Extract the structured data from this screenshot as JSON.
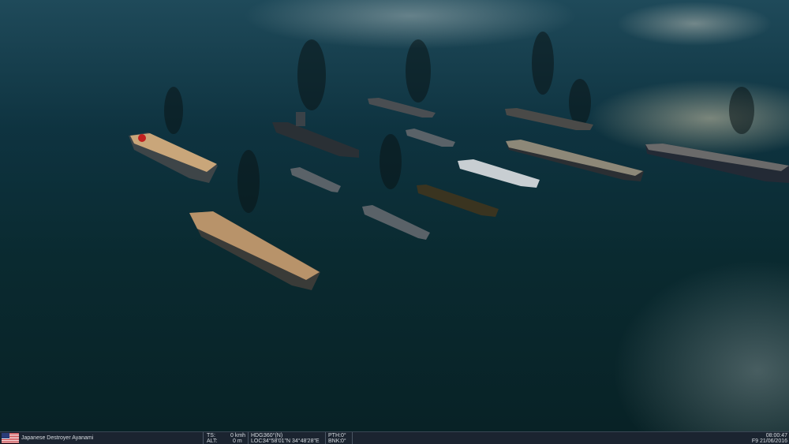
{
  "status_bar": {
    "unit_name": "Japanese Destroyer Ayanami",
    "ts_label": "TS:",
    "ts_value": "0 kmh",
    "alt_label": "ALT:",
    "alt_value": "0 m",
    "hdg_label": "HDG:",
    "hdg_value": "360°(N)",
    "loc_label": "LOC:",
    "loc_value": "34°58'01\"N 34°48'28\"E",
    "pth_label": "PTH:",
    "pth_value": "0°",
    "bnk_label": "BNK:",
    "bnk_value": "0°",
    "time": "08:00:47",
    "date": "F9 21/06/2016"
  },
  "colors": {
    "sea_dark": "#082226",
    "status_bg": "#1b2430",
    "carrier_deck": "#c9a67a"
  },
  "icons": {
    "flag": "us-flag-icon"
  }
}
